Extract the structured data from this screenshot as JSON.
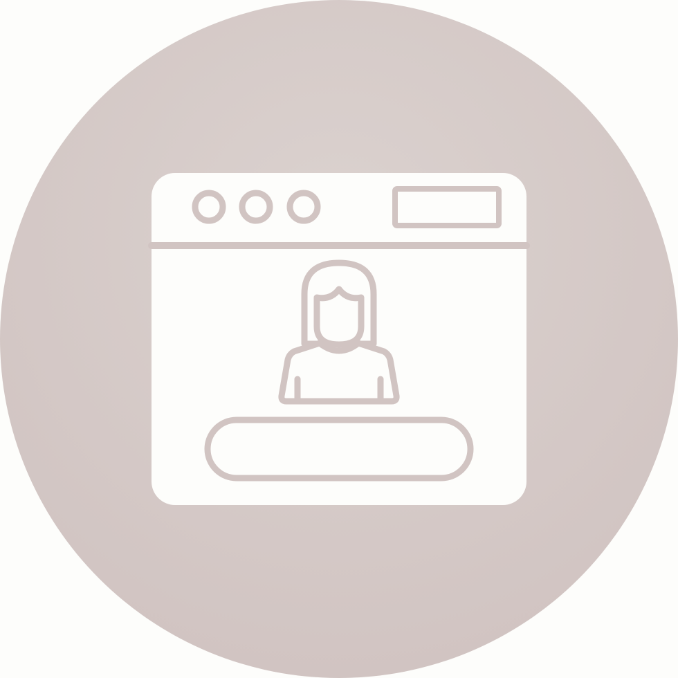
{
  "icon": {
    "name": "web-profile-icon",
    "background_color": "#d1c4c2",
    "background_gradient_center": "#dbd2cf",
    "foreground_color": "#fdfdfb",
    "stroke_color": "#d1c4c2",
    "components": [
      "browser-window-icon",
      "window-dot-icon",
      "address-bar-icon",
      "female-user-icon",
      "input-bar-icon"
    ]
  }
}
